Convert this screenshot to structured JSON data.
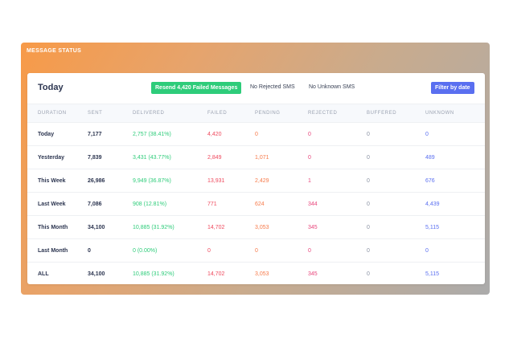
{
  "panel": {
    "title": "MESSAGE STATUS"
  },
  "card": {
    "title": "Today",
    "resend_button": "Resend 4,420 Failed Messages",
    "no_rejected": "No Rejected SMS",
    "no_unknown": "No Unknown SMS",
    "filter_button": "Filter by date"
  },
  "table": {
    "headers": [
      "DURATION",
      "SENT",
      "DELIVERED",
      "FAILED",
      "PENDING",
      "REJECTED",
      "BUFFERED",
      "UNKNOWN"
    ],
    "rows": [
      {
        "duration": "Today",
        "sent": "7,177",
        "delivered": "2,757 (38.41%)",
        "failed": "4,420",
        "pending": "0",
        "rejected": "0",
        "buffered": "0",
        "unknown": "0"
      },
      {
        "duration": "Yesterday",
        "sent": "7,839",
        "delivered": "3,431 (43.77%)",
        "failed": "2,849",
        "pending": "1,071",
        "rejected": "0",
        "buffered": "0",
        "unknown": "489"
      },
      {
        "duration": "This Week",
        "sent": "26,986",
        "delivered": "9,949 (36.87%)",
        "failed": "13,931",
        "pending": "2,429",
        "rejected": "1",
        "buffered": "0",
        "unknown": "676"
      },
      {
        "duration": "Last Week",
        "sent": "7,086",
        "delivered": "908 (12.81%)",
        "failed": "771",
        "pending": "624",
        "rejected": "344",
        "buffered": "0",
        "unknown": "4,439"
      },
      {
        "duration": "This Month",
        "sent": "34,100",
        "delivered": "10,885 (31.92%)",
        "failed": "14,702",
        "pending": "3,053",
        "rejected": "345",
        "buffered": "0",
        "unknown": "5,115"
      },
      {
        "duration": "Last Month",
        "sent": "0",
        "delivered": "0 (0.00%)",
        "failed": "0",
        "pending": "0",
        "rejected": "0",
        "buffered": "0",
        "unknown": "0"
      },
      {
        "duration": "ALL",
        "sent": "34,100",
        "delivered": "10,885 (31.92%)",
        "failed": "14,702",
        "pending": "3,053",
        "rejected": "345",
        "buffered": "0",
        "unknown": "5,115"
      }
    ]
  },
  "colors": {
    "delivered": "#2ecc7a",
    "failed": "#ef4a5e",
    "pending": "#f77a4a",
    "rejected": "#e8467c",
    "buffered": "#8a92a3",
    "unknown": "#5a6ff0",
    "resend_button_bg": "#2ecc7a",
    "filter_button_bg": "#5a6ff0"
  }
}
